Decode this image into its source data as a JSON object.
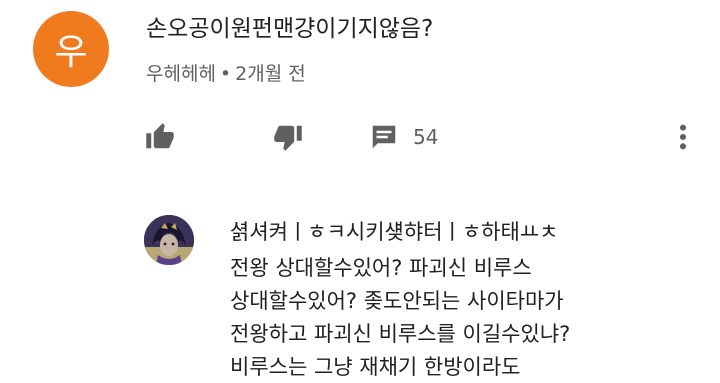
{
  "comment": {
    "avatar_letter": "우",
    "avatar_color": "#f07a1e",
    "text": "손오공이원펀맨걍이기지않음?",
    "author": "우헤헤헤",
    "separator": "•",
    "time": "2개월 전"
  },
  "actions": {
    "like_icon": "thumbs-up-icon",
    "dislike_icon": "thumbs-down-icon",
    "reply_icon": "reply-comment-icon",
    "reply_count": "54",
    "more_icon": "more-vertical-icon"
  },
  "reply": {
    "author": "셝셔켜ㅣㅎㅋ시키섖햐터ㅣㅎ하태ㅛㅊ",
    "lines": [
      "전왕 상대할수있어? 파괴신 비루스",
      "상대할수있어? 좆도안되는 사이타마가",
      "전왕하고 파괴신 비루스를 이길수있냐?",
      "비루스는 그냥 재채기 한방이라도"
    ]
  }
}
